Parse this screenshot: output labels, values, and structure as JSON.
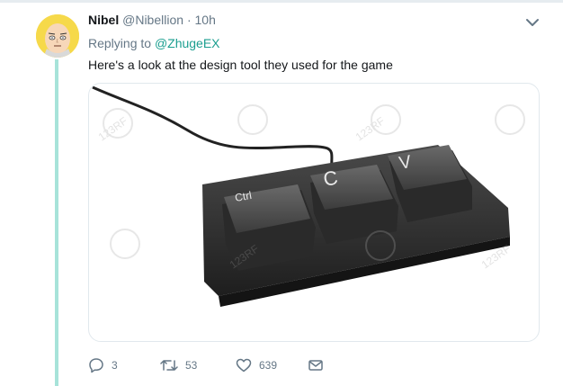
{
  "tweet": {
    "author_name": "Nibel",
    "author_handle": "@Nibellion",
    "separator": "·",
    "timestamp": "10h",
    "replying_to_label": "Replying to",
    "replying_to_handle": "@ZhugeEX",
    "text": "Here's a look at the design tool they used for the game",
    "media": {
      "keys": [
        "Ctrl",
        "C",
        "V"
      ],
      "watermark": "123RF"
    },
    "actions": {
      "reply_count": "3",
      "retweet_count": "53",
      "like_count": "639"
    }
  },
  "colors": {
    "thread_line": "#a7e3d9",
    "mention": "#1a9e8f",
    "muted": "#657786"
  },
  "icons": {
    "more": "chevron-down-icon",
    "reply": "reply-icon",
    "retweet": "retweet-icon",
    "like": "heart-icon",
    "dm": "envelope-icon"
  }
}
